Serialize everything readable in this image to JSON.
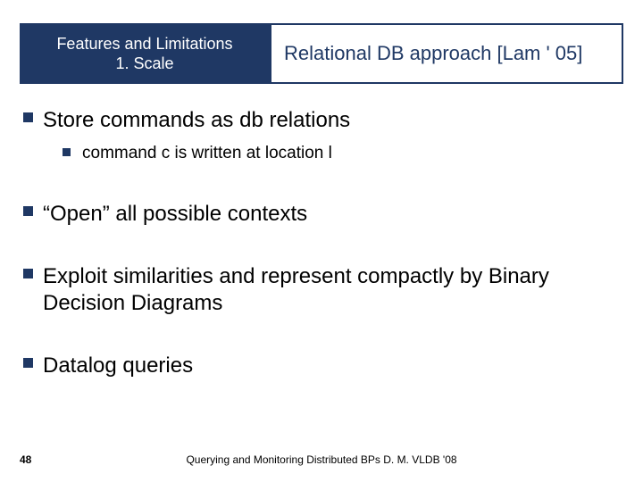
{
  "header": {
    "left_line1": "Features and Limitations",
    "left_line2": "1. Scale",
    "right": "Relational DB approach [Lam ' 05]"
  },
  "bullets": [
    {
      "text": "Store commands as db relations",
      "sub": [
        "command c is written at location l"
      ]
    },
    {
      "text": "“Open” all possible contexts"
    },
    {
      "text": "Exploit similarities and represent compactly by Binary Decision Diagrams"
    },
    {
      "text": "Datalog queries"
    }
  ],
  "page_number": "48",
  "footer": "Querying and Monitoring Distributed BPs D. M. VLDB '08"
}
